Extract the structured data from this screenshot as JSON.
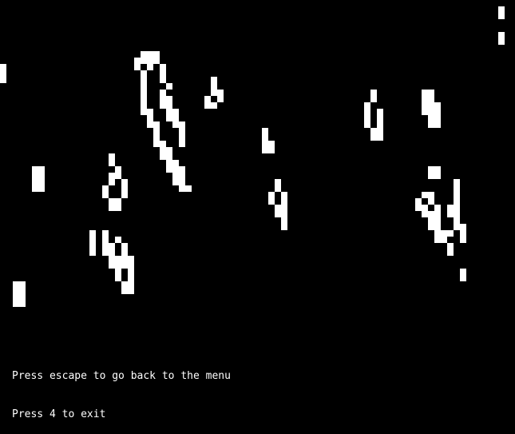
{
  "game": {
    "background_color": "#000000",
    "cell_color": "#ffffff",
    "grid_rows": 52,
    "grid_cols": 80,
    "live_cells": [
      [
        1,
        78
      ],
      [
        2,
        78
      ],
      [
        5,
        78
      ],
      [
        6,
        78
      ],
      [
        8,
        22
      ],
      [
        8,
        23
      ],
      [
        8,
        24
      ],
      [
        9,
        21
      ],
      [
        9,
        22
      ],
      [
        9,
        23
      ],
      [
        9,
        24
      ],
      [
        10,
        0
      ],
      [
        10,
        21
      ],
      [
        10,
        23
      ],
      [
        10,
        25
      ],
      [
        11,
        0
      ],
      [
        11,
        22
      ],
      [
        11,
        25
      ],
      [
        12,
        0
      ],
      [
        12,
        22
      ],
      [
        12,
        25
      ],
      [
        12,
        33
      ],
      [
        13,
        22
      ],
      [
        13,
        26
      ],
      [
        13,
        33
      ],
      [
        14,
        22
      ],
      [
        14,
        25
      ],
      [
        14,
        33
      ],
      [
        14,
        34
      ],
      [
        14,
        58
      ],
      [
        14,
        66
      ],
      [
        14,
        67
      ],
      [
        15,
        22
      ],
      [
        15,
        25
      ],
      [
        15,
        26
      ],
      [
        15,
        32
      ],
      [
        15,
        34
      ],
      [
        15,
        58
      ],
      [
        15,
        66
      ],
      [
        15,
        67
      ],
      [
        16,
        22
      ],
      [
        16,
        25
      ],
      [
        16,
        26
      ],
      [
        16,
        32
      ],
      [
        16,
        33
      ],
      [
        16,
        57
      ],
      [
        16,
        66
      ],
      [
        16,
        67
      ],
      [
        16,
        68
      ],
      [
        17,
        22
      ],
      [
        17,
        23
      ],
      [
        17,
        26
      ],
      [
        17,
        27
      ],
      [
        17,
        57
      ],
      [
        17,
        59
      ],
      [
        17,
        66
      ],
      [
        17,
        67
      ],
      [
        17,
        68
      ],
      [
        18,
        23
      ],
      [
        18,
        26
      ],
      [
        18,
        27
      ],
      [
        18,
        57
      ],
      [
        18,
        59
      ],
      [
        18,
        67
      ],
      [
        18,
        68
      ],
      [
        19,
        23
      ],
      [
        19,
        24
      ],
      [
        19,
        27
      ],
      [
        19,
        28
      ],
      [
        19,
        57
      ],
      [
        19,
        59
      ],
      [
        19,
        67
      ],
      [
        19,
        68
      ],
      [
        20,
        24
      ],
      [
        20,
        28
      ],
      [
        20,
        41
      ],
      [
        20,
        58
      ],
      [
        20,
        59
      ],
      [
        21,
        24
      ],
      [
        21,
        28
      ],
      [
        21,
        41
      ],
      [
        21,
        58
      ],
      [
        21,
        59
      ],
      [
        22,
        24
      ],
      [
        22,
        25
      ],
      [
        22,
        28
      ],
      [
        22,
        41
      ],
      [
        22,
        42
      ],
      [
        23,
        25
      ],
      [
        23,
        26
      ],
      [
        23,
        41
      ],
      [
        23,
        42
      ],
      [
        24,
        17
      ],
      [
        24,
        25
      ],
      [
        24,
        26
      ],
      [
        25,
        17
      ],
      [
        25,
        26
      ],
      [
        25,
        27
      ],
      [
        26,
        5
      ],
      [
        26,
        6
      ],
      [
        26,
        18
      ],
      [
        26,
        26
      ],
      [
        26,
        27
      ],
      [
        26,
        28
      ],
      [
        26,
        67
      ],
      [
        26,
        68
      ],
      [
        27,
        5
      ],
      [
        27,
        6
      ],
      [
        27,
        17
      ],
      [
        27,
        18
      ],
      [
        27,
        27
      ],
      [
        27,
        28
      ],
      [
        27,
        67
      ],
      [
        27,
        68
      ],
      [
        28,
        5
      ],
      [
        28,
        6
      ],
      [
        28,
        17
      ],
      [
        28,
        19
      ],
      [
        28,
        27
      ],
      [
        28,
        28
      ],
      [
        28,
        43
      ],
      [
        28,
        71
      ],
      [
        29,
        5
      ],
      [
        29,
        6
      ],
      [
        29,
        16
      ],
      [
        29,
        19
      ],
      [
        29,
        28
      ],
      [
        29,
        29
      ],
      [
        29,
        43
      ],
      [
        29,
        71
      ],
      [
        30,
        16
      ],
      [
        30,
        19
      ],
      [
        30,
        42
      ],
      [
        30,
        44
      ],
      [
        30,
        66
      ],
      [
        30,
        67
      ],
      [
        30,
        71
      ],
      [
        31,
        17
      ],
      [
        31,
        18
      ],
      [
        31,
        42
      ],
      [
        31,
        44
      ],
      [
        31,
        65
      ],
      [
        31,
        67
      ],
      [
        31,
        71
      ],
      [
        32,
        17
      ],
      [
        32,
        18
      ],
      [
        32,
        43
      ],
      [
        32,
        44
      ],
      [
        32,
        65
      ],
      [
        32,
        66
      ],
      [
        32,
        68
      ],
      [
        32,
        70
      ],
      [
        32,
        71
      ],
      [
        33,
        43
      ],
      [
        33,
        44
      ],
      [
        33,
        66
      ],
      [
        33,
        67
      ],
      [
        33,
        68
      ],
      [
        33,
        70
      ],
      [
        33,
        71
      ],
      [
        34,
        44
      ],
      [
        34,
        67
      ],
      [
        34,
        68
      ],
      [
        34,
        71
      ],
      [
        35,
        44
      ],
      [
        35,
        67
      ],
      [
        35,
        68
      ],
      [
        35,
        71
      ],
      [
        35,
        72
      ],
      [
        36,
        14
      ],
      [
        36,
        16
      ],
      [
        36,
        68
      ],
      [
        36,
        69
      ],
      [
        36,
        70
      ],
      [
        36,
        72
      ],
      [
        37,
        14
      ],
      [
        37,
        16
      ],
      [
        37,
        18
      ],
      [
        37,
        68
      ],
      [
        37,
        69
      ],
      [
        37,
        72
      ],
      [
        38,
        14
      ],
      [
        38,
        16
      ],
      [
        38,
        17
      ],
      [
        38,
        19
      ],
      [
        38,
        70
      ],
      [
        39,
        14
      ],
      [
        39,
        16
      ],
      [
        39,
        17
      ],
      [
        39,
        19
      ],
      [
        39,
        70
      ],
      [
        40,
        17
      ],
      [
        40,
        18
      ],
      [
        40,
        19
      ],
      [
        40,
        20
      ],
      [
        41,
        17
      ],
      [
        41,
        18
      ],
      [
        41,
        19
      ],
      [
        41,
        20
      ],
      [
        42,
        18
      ],
      [
        42,
        20
      ],
      [
        42,
        72
      ],
      [
        43,
        18
      ],
      [
        43,
        20
      ],
      [
        43,
        72
      ],
      [
        44,
        2
      ],
      [
        44,
        3
      ],
      [
        44,
        19
      ],
      [
        44,
        20
      ],
      [
        45,
        2
      ],
      [
        45,
        3
      ],
      [
        45,
        19
      ],
      [
        45,
        20
      ],
      [
        46,
        2
      ],
      [
        46,
        3
      ],
      [
        47,
        2
      ],
      [
        47,
        3
      ]
    ]
  },
  "instructions": {
    "line1": "Press escape to go back to the menu",
    "line2": "Press 4 to exit"
  }
}
